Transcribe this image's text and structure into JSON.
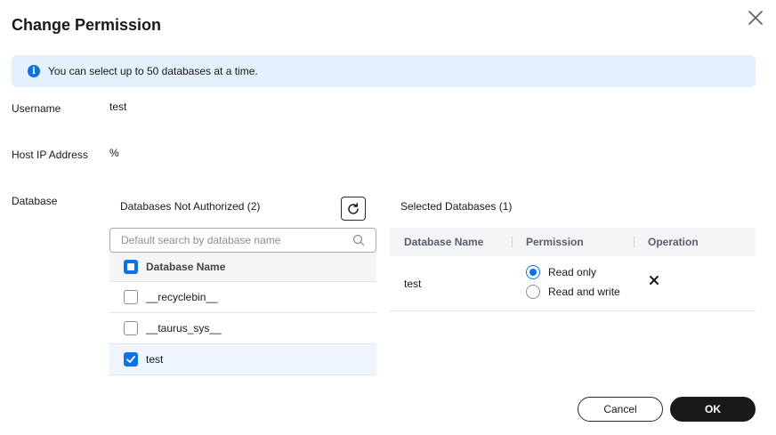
{
  "dialog": {
    "title": "Change Permission",
    "notice": "You can select up to 50 databases at a time."
  },
  "form": {
    "username_label": "Username",
    "username_value": "test",
    "host_label": "Host IP Address",
    "host_value": "%",
    "database_label": "Database"
  },
  "unauthorized": {
    "title": "Databases Not Authorized (2)",
    "search_placeholder": "Default search by database name",
    "header_label": "Database Name",
    "items": [
      {
        "label": "__recyclebin__",
        "checked": false
      },
      {
        "label": "__taurus_sys__",
        "checked": false
      },
      {
        "label": "test",
        "checked": true
      }
    ]
  },
  "selected": {
    "title": "Selected Databases (1)",
    "columns": [
      "Database Name",
      "Permission",
      "Operation"
    ],
    "rows": [
      {
        "name": "test",
        "options": [
          "Read only",
          "Read and write"
        ],
        "selected_option": "Read only"
      }
    ]
  },
  "footer": {
    "cancel_label": "Cancel",
    "ok_label": "OK"
  },
  "colors": {
    "accent": "#0c72e6",
    "notice_bg": "#e5f0ff",
    "primary_button": "#191919"
  },
  "icons": [
    "close-icon",
    "info-icon",
    "refresh-icon",
    "search-icon",
    "checkbox-icon",
    "radio-icon",
    "remove-icon"
  ]
}
